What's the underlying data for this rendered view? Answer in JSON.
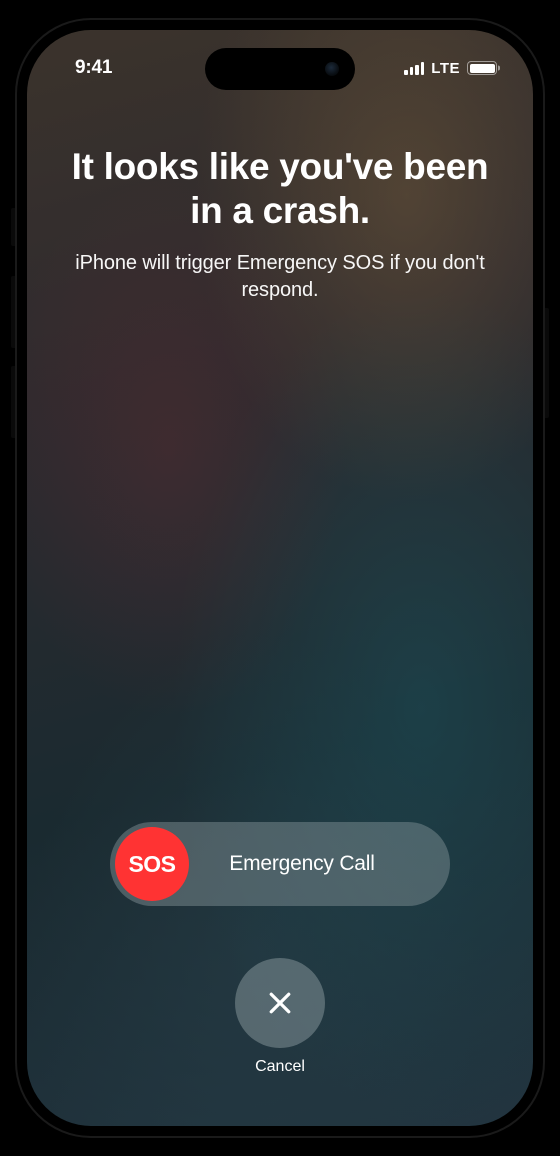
{
  "status_bar": {
    "time": "9:41",
    "network": "LTE"
  },
  "crash_alert": {
    "headline": "It looks like you've been in a crash.",
    "subheadline": "iPhone will trigger Emergency SOS if you don't respond."
  },
  "slider": {
    "thumb_label": "SOS",
    "track_label": "Emergency Call"
  },
  "cancel": {
    "label": "Cancel"
  },
  "colors": {
    "sos_red": "#ff3333"
  }
}
